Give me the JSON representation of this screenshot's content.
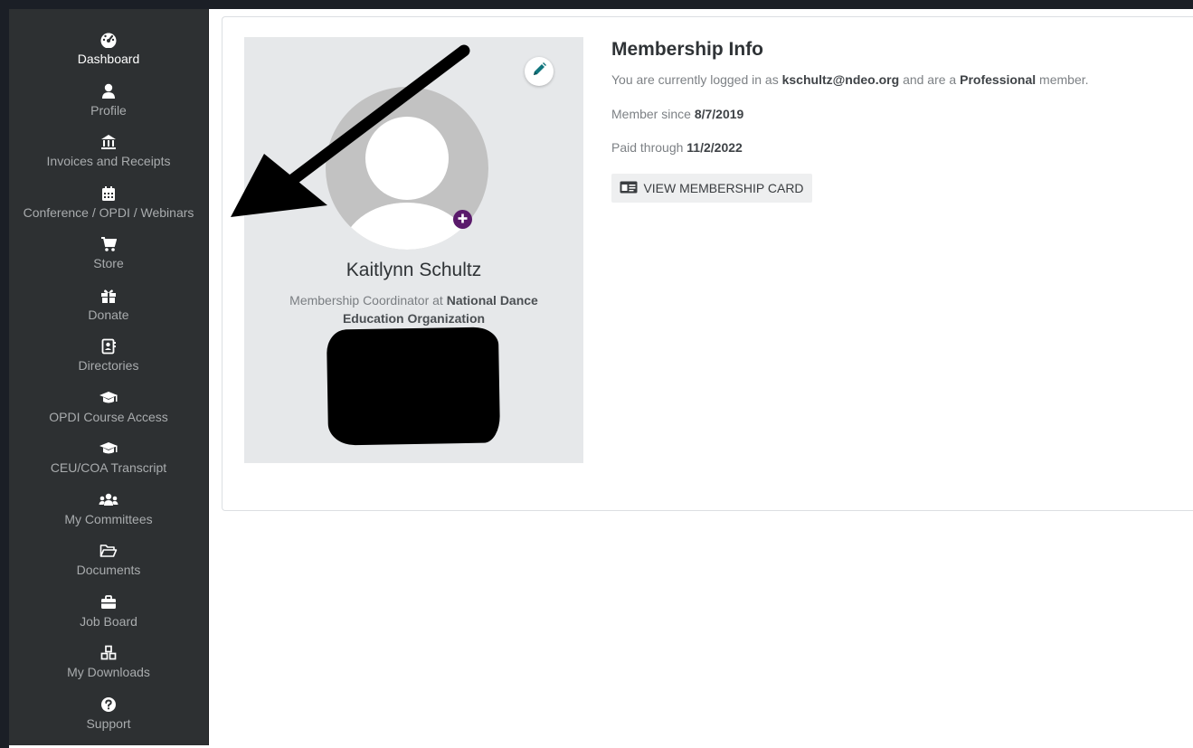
{
  "sidebar": {
    "items": [
      {
        "label": "Dashboard",
        "icon": "tachometer-icon",
        "active": true
      },
      {
        "label": "Profile",
        "icon": "user-icon"
      },
      {
        "label": "Invoices and Receipts",
        "icon": "bank-icon"
      },
      {
        "label": "Conference / OPDI / Webinars",
        "icon": "calendar-icon"
      },
      {
        "label": "Store",
        "icon": "shopping-cart-icon"
      },
      {
        "label": "Donate",
        "icon": "gift-icon"
      },
      {
        "label": "Directories",
        "icon": "address-book-icon"
      },
      {
        "label": "OPDI Course Access",
        "icon": "graduation-cap-icon"
      },
      {
        "label": "CEU/COA Transcript",
        "icon": "graduation-cap-icon"
      },
      {
        "label": "My Committees",
        "icon": "users-icon"
      },
      {
        "label": "Documents",
        "icon": "folder-open-icon"
      },
      {
        "label": "Job Board",
        "icon": "briefcase-icon"
      },
      {
        "label": "My Downloads",
        "icon": "cubes-icon"
      },
      {
        "label": "Support",
        "icon": "question-circle-icon"
      }
    ]
  },
  "profile": {
    "name": "Kaitlynn Schultz",
    "role": "Membership Coordinator",
    "at": "at",
    "organization": "National Dance Education Organization"
  },
  "membership": {
    "title": "Membership Info",
    "logged_prefix": "You are currently logged in as",
    "email": "kschultz@ndeo.org",
    "logged_middle": "and are a",
    "level": "Professional",
    "logged_suffix": "member.",
    "since_label": "Member since",
    "since_date": "8/7/2019",
    "paid_label": "Paid through",
    "paid_date": "11/2/2022",
    "card_button": "VIEW MEMBERSHIP CARD"
  },
  "colors": {
    "sidebar_bg": "#2d3032",
    "accent_edit": "#11767e",
    "accent_add": "#5a1a6b"
  }
}
